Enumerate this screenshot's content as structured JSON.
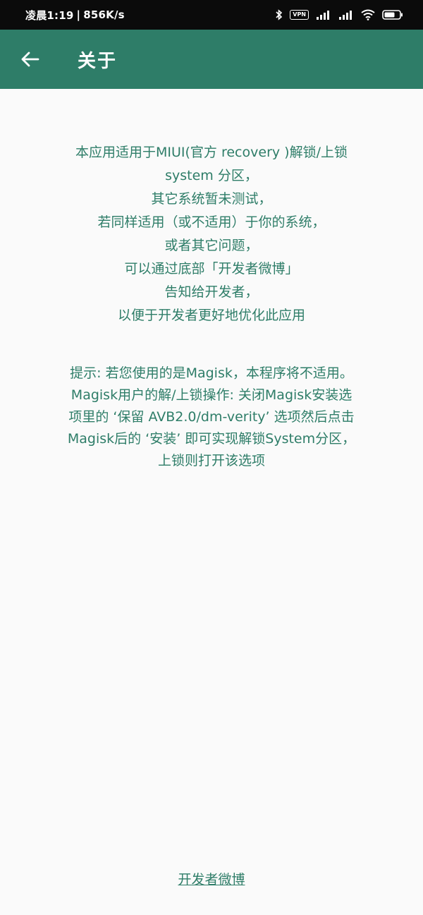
{
  "status_bar": {
    "time": "凌晨1:19",
    "separator": "|",
    "speed": "856K/s",
    "vpn": "VPN"
  },
  "app_bar": {
    "title": "关于"
  },
  "about_lines": [
    "本应用适用于MIUI(官方 recovery )解锁/上锁",
    "system 分区，",
    "其它系统暂未测试，",
    "若同样适用（或不适用）于你的系统，",
    "或者其它问题，",
    "可以通过底部「开发者微博」",
    "告知给开发者，",
    "以便于开发者更好地优化此应用"
  ],
  "tip_lines": [
    "提示: 若您使用的是Magisk，本程序将不适用。",
    "Magisk用户的解/上锁操作: 关闭Magisk安装选",
    "项里的 ‘保留 AVB2.0/dm-verity’ 选项然后点击",
    "Magisk后的 ‘安装’ 即可实现解锁System分区，",
    "上锁则打开该选项"
  ],
  "footer": {
    "link_label": "开发者微博"
  },
  "colors": {
    "primary": "#2e7d68",
    "background": "#fafafa",
    "status_bar": "#0b0b0b"
  }
}
